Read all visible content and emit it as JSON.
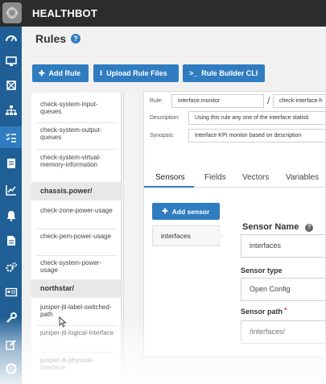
{
  "app": {
    "brand": "HEALTHBOT"
  },
  "colors": {
    "topbar": "#2c2c2c",
    "leftnav": "#1f5f95",
    "accent": "#2f7cc0"
  },
  "nav": {
    "icons": [
      "dashboard-icon",
      "monitor-icon",
      "device-icon",
      "hierarchy-icon",
      "rules-icon",
      "playbook-icon",
      "chart-icon",
      "alert-icon",
      "report-icon",
      "settings-icon",
      "card-icon",
      "wrench-icon",
      "edit-icon",
      "help-ring-icon"
    ],
    "active": "rules-icon"
  },
  "page": {
    "title": "Rules",
    "help": "?"
  },
  "toolbar": {
    "add_rule": "Add Rule",
    "upload_rule_files": "Upload Rule Files",
    "rule_builder_cli": "Rule Builder CLI"
  },
  "rule_list": {
    "items": [
      {
        "label": "check-system-input-queues",
        "type": "item"
      },
      {
        "label": "check-system-output-queues",
        "type": "item"
      },
      {
        "label": "check-system-virtual-memory-information",
        "type": "item"
      },
      {
        "label": "chassis.power/",
        "type": "group"
      },
      {
        "label": "check-zone-power-usage",
        "type": "item"
      },
      {
        "label": "check-pem-power-usage",
        "type": "item"
      },
      {
        "label": "check-system-power-usage",
        "type": "item"
      },
      {
        "label": "northstar/",
        "type": "group"
      },
      {
        "label": "juniper-jti-label-switched-path",
        "type": "item"
      },
      {
        "label": "juniper-jti-logical-interface",
        "type": "item"
      },
      {
        "label": "juniper-jti-physical-interface",
        "type": "item"
      }
    ]
  },
  "editor": {
    "rule_label": "Rule:",
    "rule_topic": "interface.monitor",
    "rule_separator": "/",
    "rule_name": "check-interface-h",
    "description_label": "Description:",
    "description": "Using this rule any one of the interface statisti",
    "synopsis_label": "Synopsis:",
    "synopsis": "Interface KPI monitor based on description",
    "tabs": [
      "Sensors",
      "Fields",
      "Vectors",
      "Variables"
    ],
    "active_tab": "Sensors",
    "add_sensor": "Add sensor",
    "sensors": [
      "interfaces"
    ],
    "sensor_name_label": "Sensor Name",
    "sensor_name_help": "?",
    "sensor_name": "interfaces",
    "sensor_type_label": "Sensor type",
    "sensor_type": "Open Config",
    "sensor_path_label": "Sensor path",
    "sensor_path_required": "*",
    "sensor_path": "/interfaces/"
  }
}
